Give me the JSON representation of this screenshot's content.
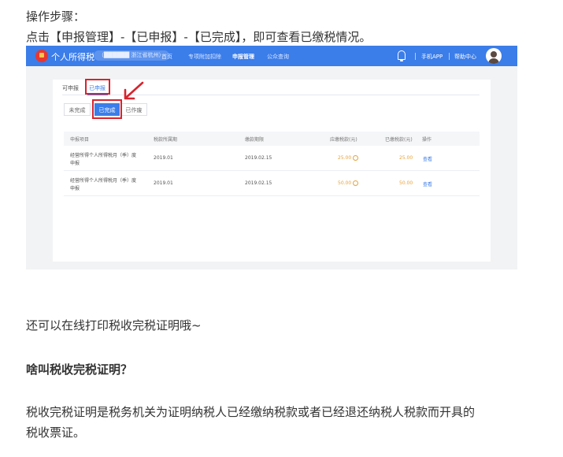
{
  "article": {
    "steps_heading": "操作步骤：",
    "step_instruction": "点击【申报管理】-【已申报】-【已完成】，即可查看已缴税情况。",
    "print_note": "还可以在线打印税收完税证明哦~",
    "question_heading": "啥叫税收完税证明？",
    "definition_line1": "税收完税证明是税务机关为证明纳税人已经缴纳税款或者已经退还纳税人税款而开具的",
    "definition_line2": "税收票证。"
  },
  "app": {
    "title": "个人所得税",
    "location": "（██████ 浙江省杭州）",
    "nav": [
      "首页",
      "专项附加扣除",
      "申报管理",
      "公众查询"
    ],
    "active_nav": "申报管理",
    "mobile_link": "手机APP",
    "help_link": "帮助中心",
    "brand_color": "#3b7de9"
  },
  "tabs": {
    "unfiled": "可申报",
    "filed": "已申报"
  },
  "subtabs": {
    "pending": "未完成",
    "completed": "已完成",
    "voided": "已作废"
  },
  "table": {
    "headers": [
      "申报项目",
      "税款所属期",
      "缴款期限",
      "应缴税款(元)",
      "已缴税款(元)",
      "操作"
    ],
    "rows": [
      {
        "item_line1": "经营所得个人所得税月（季）度",
        "item_line2": "申报",
        "period": "2019.01",
        "deadline": "2019.02.15",
        "due": "25.00",
        "paid": "25.00",
        "action": "查看"
      },
      {
        "item_line1": "经营所得个人所得税月（季）度",
        "item_line2": "申报",
        "period": "2019.01",
        "deadline": "2019.02.15",
        "due": "50.00",
        "paid": "50.00",
        "action": "查看"
      }
    ]
  },
  "highlight_color": "#d9232d",
  "icons": [
    "logo-icon",
    "bell-icon",
    "avatar",
    "info-icon",
    "red-arrow-icon"
  ]
}
